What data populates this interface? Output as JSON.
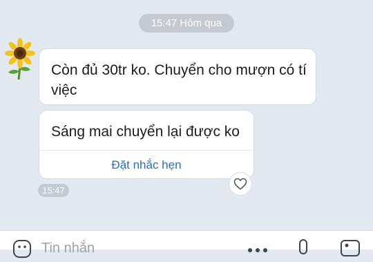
{
  "header": {
    "day_label": "15:47 Hôm qua"
  },
  "messages": [
    {
      "text": "Còn đủ 30tr ko. Chuyển cho mượn có tí việc"
    },
    {
      "text": "Sáng mai chuyển lại được ko",
      "reminder_label": "Đặt nhắc hẹn",
      "time": "15:47"
    }
  ],
  "composer": {
    "placeholder": "Tin nhắn"
  },
  "icons": {
    "avatar": "sunflower-avatar",
    "like": "heart-icon",
    "emoji": "emoji-icon",
    "more": "more-icon",
    "mic": "mic-icon",
    "image": "image-icon"
  },
  "colors": {
    "background": "#e2e9f1",
    "accent": "#1f6fc5",
    "pill": "#c3cad2"
  }
}
